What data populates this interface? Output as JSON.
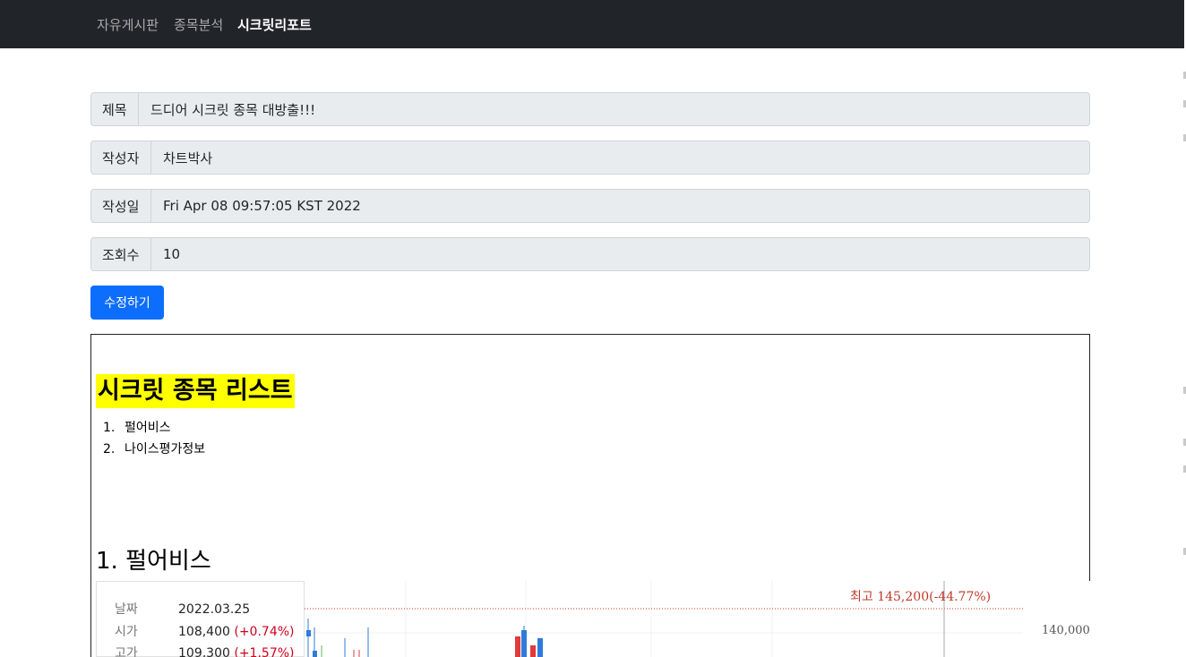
{
  "nav": {
    "items": [
      "자유게시판",
      "종목분석",
      "시크릿리포트"
    ]
  },
  "form": {
    "title_label": "제목",
    "title_value": "드디어 시크릿 종목 대방출!!!",
    "author_label": "작성자",
    "author_value": "차트박사",
    "date_label": "작성일",
    "date_value": "Fri Apr 08 09:57:05 KST 2022",
    "views_label": "조회수",
    "views_value": "10",
    "edit_button": "수정하기"
  },
  "post": {
    "heading": "시크릿 종목 리스트",
    "list": [
      "펄어비스",
      "나이스평가정보"
    ],
    "section_title": "1. 펄어비스"
  },
  "chart": {
    "info": [
      {
        "key": "날짜",
        "value": "2022.03.25",
        "change": ""
      },
      {
        "key": "시가",
        "value": "108,400",
        "change": "(+0.74%)"
      },
      {
        "key": "고가",
        "value": "109,300",
        "change": "(+1.57%)"
      }
    ],
    "high_label": "최고 145,200(-44.77%)",
    "y_tick": "140,000",
    "colors": {
      "up": "#e03a3a",
      "down": "#2f7bd9",
      "high_line": "#c0392b"
    }
  }
}
